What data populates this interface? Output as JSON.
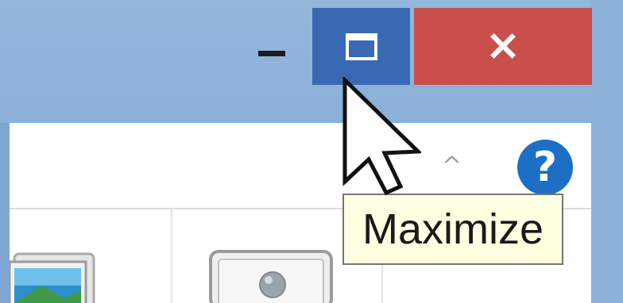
{
  "window": {
    "caption_buttons": {
      "minimize": {
        "label": "–",
        "icon": "minimize-icon"
      },
      "maximize": {
        "label": "",
        "icon": "maximize-icon"
      },
      "close": {
        "label": "×",
        "icon": "close-icon"
      }
    }
  },
  "ribbon": {
    "collapse_label": "^",
    "help_label": "?"
  },
  "tooltip": {
    "text": "Maximize"
  },
  "colors": {
    "maximize_hover": "#3a69b3",
    "close": "#c94f4d",
    "frame": "#8cb1d9",
    "help": "#1c6fc4",
    "tooltip_bg": "#ffffe1"
  }
}
